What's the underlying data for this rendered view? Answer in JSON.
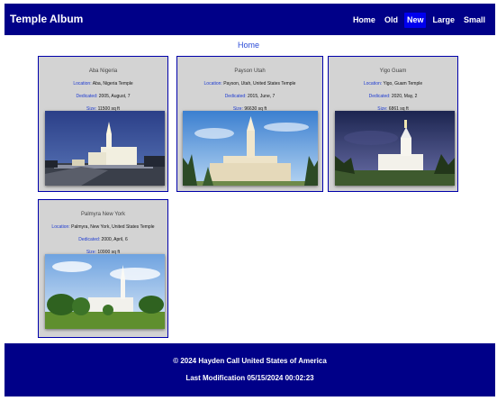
{
  "header": {
    "title": "Temple Album",
    "nav": [
      "Home",
      "Old",
      "New",
      "Large",
      "Small"
    ],
    "active": "New"
  },
  "breadcrumb": "Home",
  "temples": [
    {
      "name": "Aba Nigeria",
      "location": "Aba, Nigeria Temple",
      "dedicated": "2005, August, 7",
      "size": "11500 sq ft",
      "photo": "temple-night-photo"
    },
    {
      "name": "Payson Utah",
      "location": "Payson, Utah, United States Temple",
      "dedicated": "2015, June, 7",
      "size": "96630 sq ft",
      "photo": "temple-blue-sky-photo"
    },
    {
      "name": "Yigo Guam",
      "location": "Yigo, Guam Temple",
      "dedicated": "2020, May, 2",
      "size": "6861 sq ft",
      "photo": "temple-dusk-photo"
    },
    {
      "name": "Palmyra New York",
      "location": "Palmyra, New York, United States Temple",
      "dedicated": "2000, April, 6",
      "size": "10900 sq ft",
      "photo": "temple-trees-photo"
    }
  ],
  "labels": {
    "location": "Location:",
    "dedicated": "Dedicated:",
    "size": "Size:"
  },
  "footer": {
    "copyright": "© 2024 Hayden Call United States of America",
    "modified": "Last Modification 05/15/2024 00:02:23"
  },
  "colors": {
    "brand": "#000088",
    "active_nav": "#0000ee",
    "card_bg": "#d3d3d3",
    "link": "#2a4bd7"
  }
}
